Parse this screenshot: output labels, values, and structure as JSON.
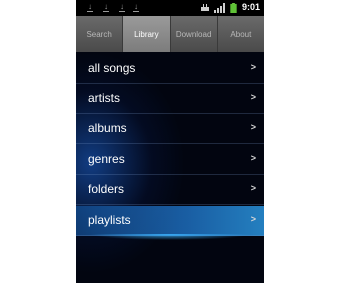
{
  "status_bar": {
    "time": "9:01"
  },
  "tabs": [
    {
      "label": "Search",
      "active": false
    },
    {
      "label": "Library",
      "active": true
    },
    {
      "label": "Download",
      "active": false
    },
    {
      "label": "About",
      "active": false
    }
  ],
  "list": {
    "items": [
      {
        "label": "all songs",
        "chevron": ">"
      },
      {
        "label": "artists",
        "chevron": ">"
      },
      {
        "label": "albums",
        "chevron": ">"
      },
      {
        "label": "genres",
        "chevron": ">"
      },
      {
        "label": "folders",
        "chevron": ">"
      },
      {
        "label": "playlists",
        "chevron": ">",
        "selected": true
      }
    ]
  },
  "colors": {
    "background": "#020510",
    "accent": "#2a8ad2",
    "tab_bar": "#5a5a5a",
    "tab_active": "#8a8a8a"
  }
}
